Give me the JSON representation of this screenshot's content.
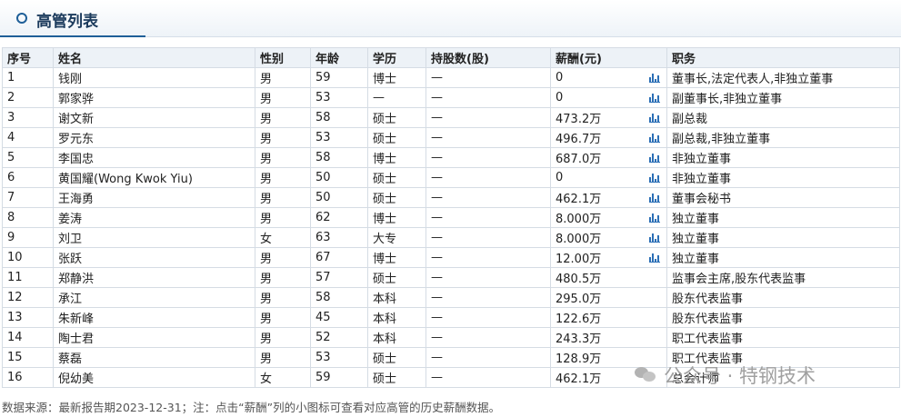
{
  "header": {
    "title": "高管列表"
  },
  "columns": [
    "序号",
    "姓名",
    "性别",
    "年龄",
    "学历",
    "持股数(股)",
    "薪酬(元)",
    "职务"
  ],
  "rows": [
    {
      "no": "1",
      "name": "钱刚",
      "gender": "男",
      "age": "59",
      "edu": "博士",
      "shares": "—",
      "salary": "0",
      "chart": true,
      "title": "董事长,法定代表人,非独立董事"
    },
    {
      "no": "2",
      "name": "郭家骅",
      "gender": "男",
      "age": "53",
      "edu": "—",
      "shares": "—",
      "salary": "0",
      "chart": true,
      "title": "副董事长,非独立董事"
    },
    {
      "no": "3",
      "name": "谢文新",
      "gender": "男",
      "age": "58",
      "edu": "硕士",
      "shares": "—",
      "salary": "473.2万",
      "chart": true,
      "title": "副总裁"
    },
    {
      "no": "4",
      "name": "罗元东",
      "gender": "男",
      "age": "53",
      "edu": "硕士",
      "shares": "—",
      "salary": "496.7万",
      "chart": true,
      "title": "副总裁,非独立董事"
    },
    {
      "no": "5",
      "name": "李国忠",
      "gender": "男",
      "age": "58",
      "edu": "博士",
      "shares": "—",
      "salary": "687.0万",
      "chart": true,
      "title": "非独立董事"
    },
    {
      "no": "6",
      "name": "黄国耀(Wong Kwok Yiu)",
      "gender": "男",
      "age": "50",
      "edu": "硕士",
      "shares": "—",
      "salary": "0",
      "chart": true,
      "title": "非独立董事"
    },
    {
      "no": "7",
      "name": "王海勇",
      "gender": "男",
      "age": "50",
      "edu": "硕士",
      "shares": "—",
      "salary": "462.1万",
      "chart": true,
      "title": "董事会秘书"
    },
    {
      "no": "8",
      "name": "姜涛",
      "gender": "男",
      "age": "62",
      "edu": "博士",
      "shares": "—",
      "salary": "8.000万",
      "chart": true,
      "title": "独立董事"
    },
    {
      "no": "9",
      "name": "刘卫",
      "gender": "女",
      "age": "63",
      "edu": "大专",
      "shares": "—",
      "salary": "8.000万",
      "chart": true,
      "title": "独立董事"
    },
    {
      "no": "10",
      "name": "张跃",
      "gender": "男",
      "age": "67",
      "edu": "博士",
      "shares": "—",
      "salary": "12.00万",
      "chart": true,
      "title": "独立董事"
    },
    {
      "no": "11",
      "name": "郑静洪",
      "gender": "男",
      "age": "57",
      "edu": "硕士",
      "shares": "—",
      "salary": "480.5万",
      "chart": false,
      "title": "监事会主席,股东代表监事"
    },
    {
      "no": "12",
      "name": "承江",
      "gender": "男",
      "age": "58",
      "edu": "本科",
      "shares": "—",
      "salary": "295.0万",
      "chart": false,
      "title": "股东代表监事"
    },
    {
      "no": "13",
      "name": "朱新峰",
      "gender": "男",
      "age": "45",
      "edu": "本科",
      "shares": "—",
      "salary": "122.6万",
      "chart": false,
      "title": "股东代表监事"
    },
    {
      "no": "14",
      "name": "陶士君",
      "gender": "男",
      "age": "52",
      "edu": "本科",
      "shares": "—",
      "salary": "243.3万",
      "chart": false,
      "title": "职工代表监事"
    },
    {
      "no": "15",
      "name": "蔡磊",
      "gender": "男",
      "age": "53",
      "edu": "硕士",
      "shares": "—",
      "salary": "128.9万",
      "chart": false,
      "title": "职工代表监事"
    },
    {
      "no": "16",
      "name": "倪幼美",
      "gender": "女",
      "age": "59",
      "edu": "硕士",
      "shares": "—",
      "salary": "462.1万",
      "chart": false,
      "title": "总会计师"
    }
  ],
  "footnote": "数据来源：最新报告期2023-12-31；注：点击“薪酬”列的小图标可查看对应高管的历史薪酬数据。",
  "watermark": "公众号 · 特钢技术",
  "icons": {
    "section": "ring-bullet-icon",
    "salary_chart": "bar-chart-icon",
    "watermark": "wechat-icon"
  },
  "colors": {
    "accent": "#1f5f98",
    "icon": "#2b6fb6",
    "header_bg": "#edf2f7"
  }
}
